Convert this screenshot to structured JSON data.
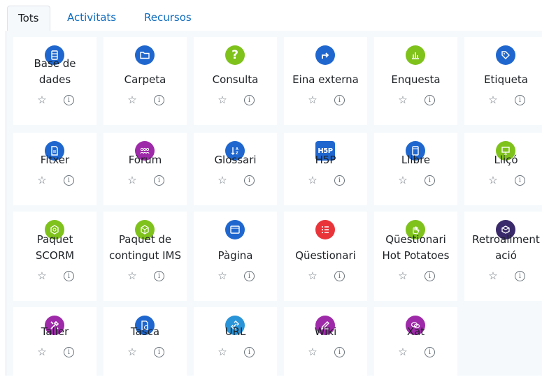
{
  "tabs": [
    {
      "label": "Tots",
      "active": true
    },
    {
      "label": "Activitats",
      "active": false
    },
    {
      "label": "Recursos",
      "active": false
    }
  ],
  "colors": {
    "blue": "#1f67cf",
    "green": "#7fc21c",
    "purple": "#9e2aa9",
    "red": "#e9353a",
    "dark": "#3a2a6b",
    "lightblue": "#2a94d8"
  },
  "modules": [
    {
      "lines": [
        "Base de",
        "dades"
      ],
      "icon": "database-icon",
      "color": "#1f67cf"
    },
    {
      "lines": [
        "Carpeta"
      ],
      "icon": "folder-icon",
      "color": "#1f67cf"
    },
    {
      "lines": [
        "Consulta"
      ],
      "icon": "question-icon",
      "color": "#7fc21c"
    },
    {
      "lines": [
        "Eina externa"
      ],
      "icon": "external-arrow-icon",
      "color": "#1f67cf"
    },
    {
      "lines": [
        "Enquesta"
      ],
      "icon": "bar-chart-icon",
      "color": "#7fc21c"
    },
    {
      "lines": [
        "Etiqueta"
      ],
      "icon": "tag-icon",
      "color": "#1f67cf"
    },
    {
      "lines": [
        "Fitxer"
      ],
      "icon": "file-icon",
      "color": "#1f67cf"
    },
    {
      "lines": [
        "Fòrum"
      ],
      "icon": "people-icon",
      "color": "#9e2aa9"
    },
    {
      "lines": [
        "Glossari"
      ],
      "icon": "sort-az-icon",
      "color": "#1f67cf"
    },
    {
      "lines": [
        "H5P"
      ],
      "icon": "h5p-logo-icon",
      "color": "#1f67cf"
    },
    {
      "lines": [
        "Llibre"
      ],
      "icon": "book-icon",
      "color": "#1f67cf"
    },
    {
      "lines": [
        "Lliçó"
      ],
      "icon": "presentation-icon",
      "color": "#7fc21c"
    },
    {
      "lines": [
        "Paquet",
        "SCORM"
      ],
      "icon": "scorm-package-icon",
      "color": "#7fc21c"
    },
    {
      "lines": [
        "Paquet de",
        "contingut IMS"
      ],
      "icon": "ims-package-icon",
      "color": "#7fc21c"
    },
    {
      "lines": [
        "Pàgina"
      ],
      "icon": "page-window-icon",
      "color": "#1f67cf"
    },
    {
      "lines": [
        "Qüestionari"
      ],
      "icon": "list-icon",
      "color": "#e9353a"
    },
    {
      "lines": [
        "Qüestionari",
        "Hot Potatoes"
      ],
      "icon": "hand-icon",
      "color": "#7fc21c"
    },
    {
      "lines": [
        "Retroaliment",
        "ació"
      ],
      "icon": "feedback-box-icon",
      "color": "#3a2a6b"
    },
    {
      "lines": [
        "Taller"
      ],
      "icon": "tools-icon",
      "color": "#9e2aa9"
    },
    {
      "lines": [
        "Tasca"
      ],
      "icon": "assignment-icon",
      "color": "#1f67cf"
    },
    {
      "lines": [
        "URL"
      ],
      "icon": "link-icon",
      "color": "#2a94d8"
    },
    {
      "lines": [
        "Wiki"
      ],
      "icon": "pencil-icon",
      "color": "#9e2aa9"
    },
    {
      "lines": [
        "Xat"
      ],
      "icon": "chat-icon",
      "color": "#9e2aa9"
    }
  ],
  "star_glyph": "☆",
  "info_glyph": "i"
}
